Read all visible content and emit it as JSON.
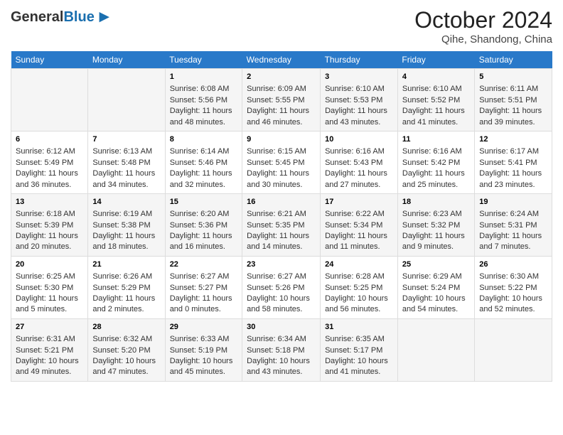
{
  "header": {
    "logo_general": "General",
    "logo_blue": "Blue",
    "main_title": "October 2024",
    "subtitle": "Qihe, Shandong, China"
  },
  "days_of_week": [
    "Sunday",
    "Monday",
    "Tuesday",
    "Wednesday",
    "Thursday",
    "Friday",
    "Saturday"
  ],
  "weeks": [
    [
      {
        "day": "",
        "content": ""
      },
      {
        "day": "",
        "content": ""
      },
      {
        "day": "1",
        "content": "Sunrise: 6:08 AM\nSunset: 5:56 PM\nDaylight: 11 hours and 48 minutes."
      },
      {
        "day": "2",
        "content": "Sunrise: 6:09 AM\nSunset: 5:55 PM\nDaylight: 11 hours and 46 minutes."
      },
      {
        "day": "3",
        "content": "Sunrise: 6:10 AM\nSunset: 5:53 PM\nDaylight: 11 hours and 43 minutes."
      },
      {
        "day": "4",
        "content": "Sunrise: 6:10 AM\nSunset: 5:52 PM\nDaylight: 11 hours and 41 minutes."
      },
      {
        "day": "5",
        "content": "Sunrise: 6:11 AM\nSunset: 5:51 PM\nDaylight: 11 hours and 39 minutes."
      }
    ],
    [
      {
        "day": "6",
        "content": "Sunrise: 6:12 AM\nSunset: 5:49 PM\nDaylight: 11 hours and 36 minutes."
      },
      {
        "day": "7",
        "content": "Sunrise: 6:13 AM\nSunset: 5:48 PM\nDaylight: 11 hours and 34 minutes."
      },
      {
        "day": "8",
        "content": "Sunrise: 6:14 AM\nSunset: 5:46 PM\nDaylight: 11 hours and 32 minutes."
      },
      {
        "day": "9",
        "content": "Sunrise: 6:15 AM\nSunset: 5:45 PM\nDaylight: 11 hours and 30 minutes."
      },
      {
        "day": "10",
        "content": "Sunrise: 6:16 AM\nSunset: 5:43 PM\nDaylight: 11 hours and 27 minutes."
      },
      {
        "day": "11",
        "content": "Sunrise: 6:16 AM\nSunset: 5:42 PM\nDaylight: 11 hours and 25 minutes."
      },
      {
        "day": "12",
        "content": "Sunrise: 6:17 AM\nSunset: 5:41 PM\nDaylight: 11 hours and 23 minutes."
      }
    ],
    [
      {
        "day": "13",
        "content": "Sunrise: 6:18 AM\nSunset: 5:39 PM\nDaylight: 11 hours and 20 minutes."
      },
      {
        "day": "14",
        "content": "Sunrise: 6:19 AM\nSunset: 5:38 PM\nDaylight: 11 hours and 18 minutes."
      },
      {
        "day": "15",
        "content": "Sunrise: 6:20 AM\nSunset: 5:36 PM\nDaylight: 11 hours and 16 minutes."
      },
      {
        "day": "16",
        "content": "Sunrise: 6:21 AM\nSunset: 5:35 PM\nDaylight: 11 hours and 14 minutes."
      },
      {
        "day": "17",
        "content": "Sunrise: 6:22 AM\nSunset: 5:34 PM\nDaylight: 11 hours and 11 minutes."
      },
      {
        "day": "18",
        "content": "Sunrise: 6:23 AM\nSunset: 5:32 PM\nDaylight: 11 hours and 9 minutes."
      },
      {
        "day": "19",
        "content": "Sunrise: 6:24 AM\nSunset: 5:31 PM\nDaylight: 11 hours and 7 minutes."
      }
    ],
    [
      {
        "day": "20",
        "content": "Sunrise: 6:25 AM\nSunset: 5:30 PM\nDaylight: 11 hours and 5 minutes."
      },
      {
        "day": "21",
        "content": "Sunrise: 6:26 AM\nSunset: 5:29 PM\nDaylight: 11 hours and 2 minutes."
      },
      {
        "day": "22",
        "content": "Sunrise: 6:27 AM\nSunset: 5:27 PM\nDaylight: 11 hours and 0 minutes."
      },
      {
        "day": "23",
        "content": "Sunrise: 6:27 AM\nSunset: 5:26 PM\nDaylight: 10 hours and 58 minutes."
      },
      {
        "day": "24",
        "content": "Sunrise: 6:28 AM\nSunset: 5:25 PM\nDaylight: 10 hours and 56 minutes."
      },
      {
        "day": "25",
        "content": "Sunrise: 6:29 AM\nSunset: 5:24 PM\nDaylight: 10 hours and 54 minutes."
      },
      {
        "day": "26",
        "content": "Sunrise: 6:30 AM\nSunset: 5:22 PM\nDaylight: 10 hours and 52 minutes."
      }
    ],
    [
      {
        "day": "27",
        "content": "Sunrise: 6:31 AM\nSunset: 5:21 PM\nDaylight: 10 hours and 49 minutes."
      },
      {
        "day": "28",
        "content": "Sunrise: 6:32 AM\nSunset: 5:20 PM\nDaylight: 10 hours and 47 minutes."
      },
      {
        "day": "29",
        "content": "Sunrise: 6:33 AM\nSunset: 5:19 PM\nDaylight: 10 hours and 45 minutes."
      },
      {
        "day": "30",
        "content": "Sunrise: 6:34 AM\nSunset: 5:18 PM\nDaylight: 10 hours and 43 minutes."
      },
      {
        "day": "31",
        "content": "Sunrise: 6:35 AM\nSunset: 5:17 PM\nDaylight: 10 hours and 41 minutes."
      },
      {
        "day": "",
        "content": ""
      },
      {
        "day": "",
        "content": ""
      }
    ]
  ]
}
